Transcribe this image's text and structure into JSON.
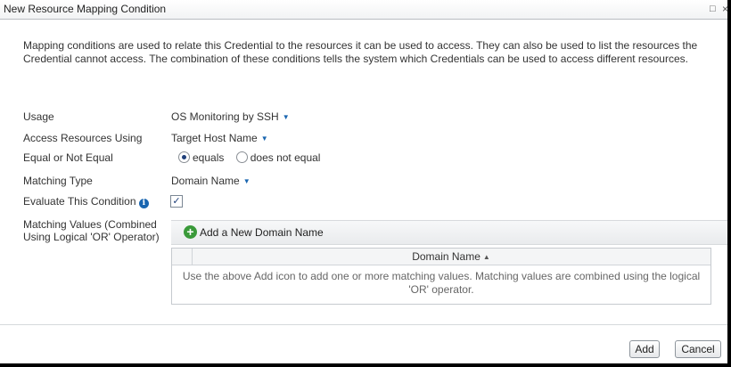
{
  "dialog": {
    "title": "New Resource Mapping Condition",
    "restore_glyph": "□",
    "close_glyph": "×"
  },
  "description": "Mapping conditions are used to relate this Credential to the resources it can be used to access. They can also be used to list the resources the Credential cannot access. The combination of these conditions tells the system which Credentials can be used to access different resources.",
  "form": {
    "usage": {
      "label": "Usage",
      "value": "OS Monitoring by SSH"
    },
    "access": {
      "label": "Access Resources Using",
      "value": "Target Host Name"
    },
    "equal": {
      "label": "Equal or Not Equal",
      "option_equals": "equals",
      "option_not_equal": "does not equal",
      "selected": "equals"
    },
    "matching_type": {
      "label": "Matching Type",
      "value": "Domain Name"
    },
    "evaluate": {
      "label": "Evaluate This Condition",
      "info_glyph": "i",
      "checked": true,
      "check_glyph": "✓"
    },
    "matching_values": {
      "label": "Matching Values (Combined Using Logical 'OR' Operator)",
      "add_label": "Add a New Domain Name",
      "add_glyph": "+",
      "column_header": "Domain Name",
      "sort_glyph": "▲",
      "empty_text": "Use the above Add icon to add one or more matching values. Matching values are combined using the logical 'OR' operator."
    }
  },
  "icons": {
    "dropdown_caret": "▼",
    "dropdown_caret_name": "chevron-down-icon"
  },
  "buttons": {
    "add": "Add",
    "cancel": "Cancel"
  },
  "colors": {
    "accent": "#1a66b0",
    "add_green": "#3a9a3a"
  }
}
